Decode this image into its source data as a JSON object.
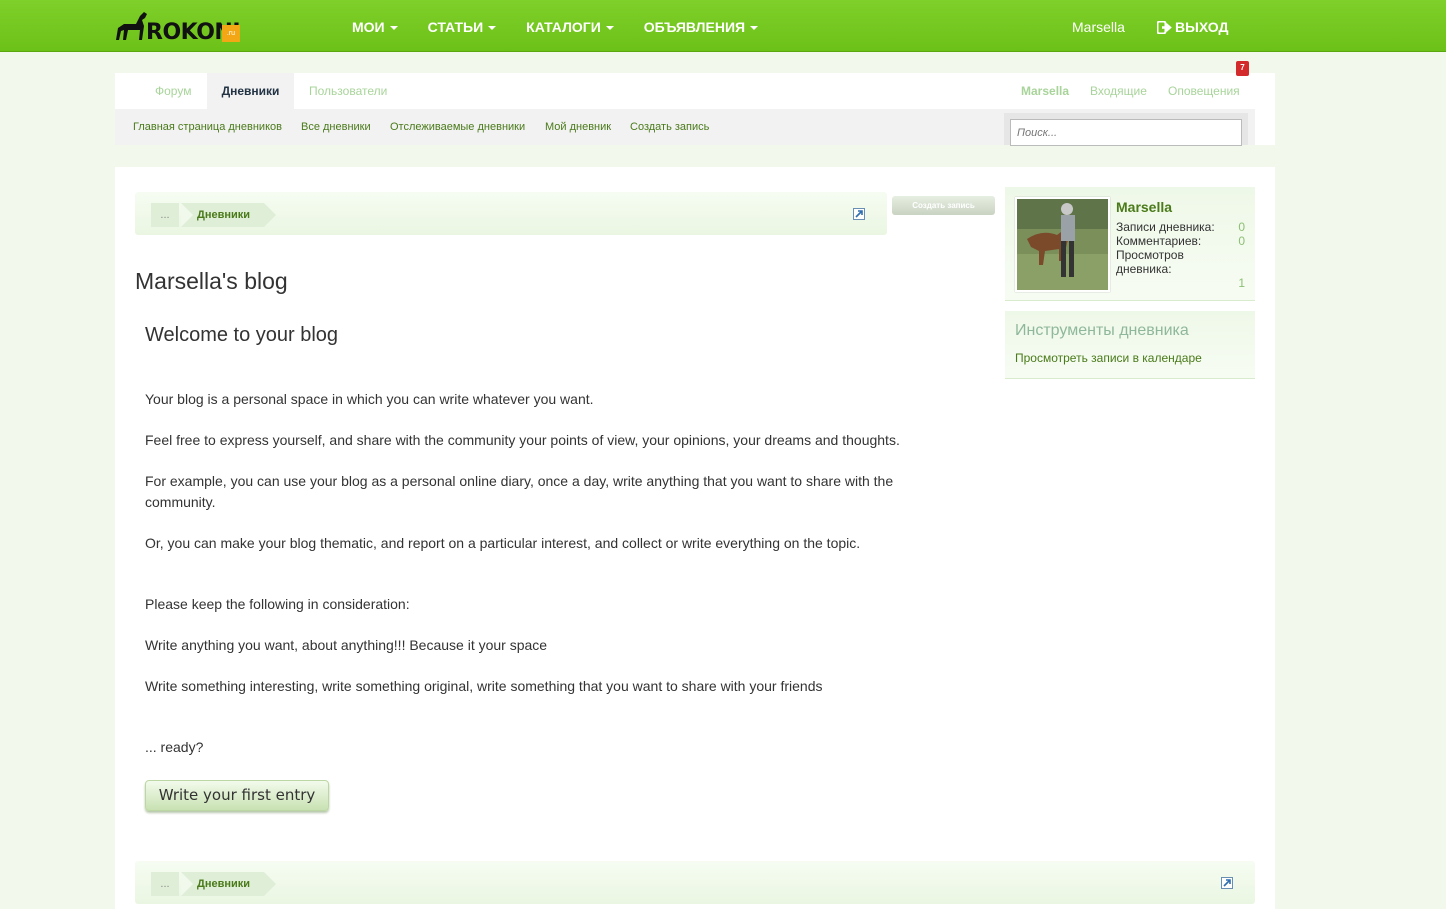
{
  "header": {
    "logo_text": "ROKONI",
    "logo_suffix": ".ru",
    "nav": [
      {
        "label": "МОИ"
      },
      {
        "label": "СТАТЬИ"
      },
      {
        "label": "КАТАЛОГИ"
      },
      {
        "label": "ОБЪЯВЛЕНИЯ"
      }
    ],
    "user": "Marsella",
    "logout": "ВЫХОД"
  },
  "tabs": {
    "forum": "Форум",
    "diaries": "Дневники",
    "users": "Пользователи"
  },
  "user_links": {
    "name": "Marsella",
    "inbox": "Входящие",
    "notifications": "Оповещения",
    "notif_count": "7"
  },
  "subnav": {
    "home": "Главная страница дневников",
    "all": "Все дневники",
    "tracked": "Отслеживаемые дневники",
    "mine": "Мой дневник",
    "create": "Создать запись",
    "search_placeholder": "Поиск..."
  },
  "breadcrumb": {
    "dots": "...",
    "item": "Дневники"
  },
  "create_button": "Создать запись",
  "blog": {
    "title": "Marsella's blog",
    "welcome": "Welcome to your blog",
    "p1": "Your blog is a personal space in which you can write whatever you want.",
    "p2": "Feel free to express yourself, and share with the community your points of view, your opinions, your dreams and thoughts.",
    "p3": "For example, you can use your blog as a personal online diary, once a day, write anything that you want to share with the community.",
    "p4": "Or, you can make your blog thematic, and report on a particular interest, and collect or write everything on the topic.",
    "p5": "Please keep the following in consideration:",
    "p6": "Write anything you want, about anything!!! Because it your space",
    "p7": "Write something interesting, write something original, write something that you want to share with your friends",
    "p8": "... ready?",
    "write_button": "Write your first entry"
  },
  "profile": {
    "name": "Marsella",
    "entries_label": "Записи дневника:",
    "entries_value": "0",
    "comments_label": "Комментариев:",
    "comments_value": "0",
    "views_label_1": "Просмотров",
    "views_label_2": "дневника:",
    "views_value": "1"
  },
  "tools": {
    "title": "Инструменты дневника",
    "calendar_link": "Просмотреть записи в календаре"
  },
  "colors": {
    "brand_green": "#74c820",
    "link_green": "#4a7a1a",
    "light_green": "#a8d49a"
  }
}
